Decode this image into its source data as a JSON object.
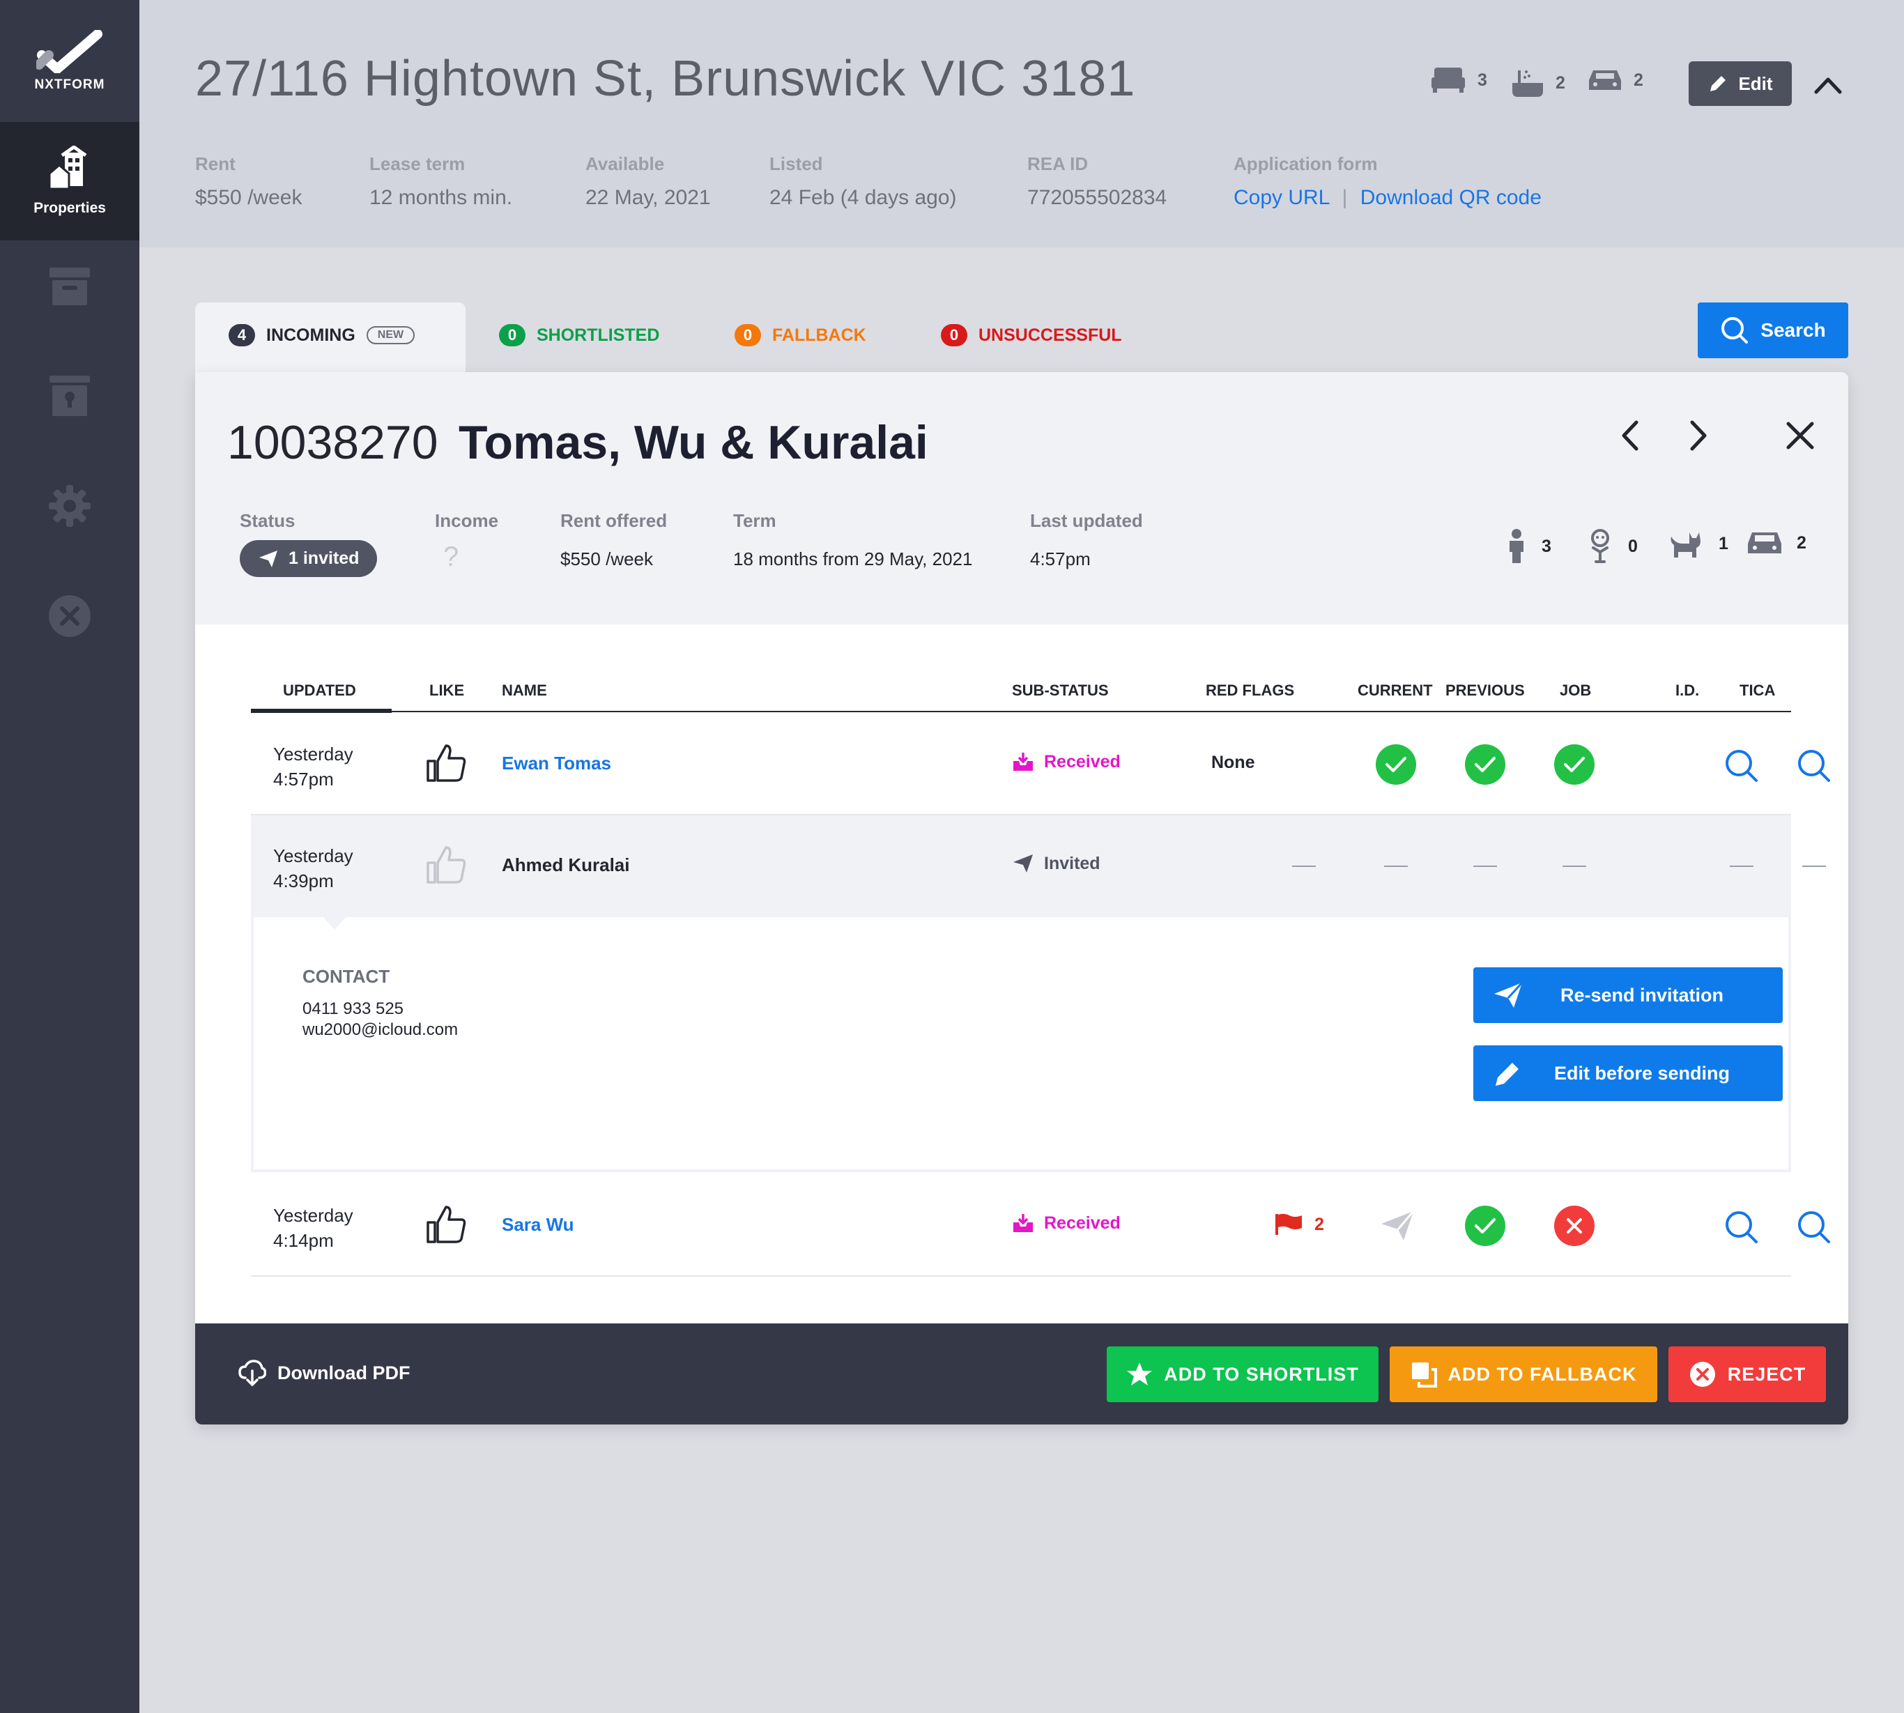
{
  "sidebar": {
    "logo_text": "NXTFORM",
    "properties_label": "Properties",
    "icons": [
      "archive-icon",
      "lockbox-icon",
      "gear-icon",
      "close-circle-icon"
    ]
  },
  "property": {
    "address": "27/116 Hightown St, Brunswick VIC 3181",
    "bedrooms": "3",
    "bathrooms": "2",
    "parking": "2",
    "edit_label": "Edit",
    "meta": [
      {
        "label": "Rent",
        "value": "$550 /week"
      },
      {
        "label": "Lease term",
        "value": "12 months min."
      },
      {
        "label": "Available",
        "value": "22 May, 2021"
      },
      {
        "label": "Listed",
        "value": "24 Feb (4 days ago)"
      },
      {
        "label": "REA ID",
        "value": "772055502834"
      }
    ],
    "application_form": {
      "label": "Application form",
      "copy_url": "Copy URL",
      "separator": "|",
      "download_qr": "Download QR code"
    }
  },
  "tabs": [
    {
      "label": "INCOMING",
      "count": "4",
      "badge": "NEW",
      "color": "#353847"
    },
    {
      "label": "SHORTLISTED",
      "count": "0",
      "color": "#0ca04a"
    },
    {
      "label": "FALLBACK",
      "count": "0",
      "color": "#f5780c"
    },
    {
      "label": "UNSUCCESSFUL",
      "count": "0",
      "color": "#d81a1a"
    }
  ],
  "search_label": "Search",
  "application": {
    "id": "10038270",
    "names": "Tomas, Wu & Kuralai",
    "status_label": "Status",
    "status_value": "1 invited",
    "income_label": "Income",
    "income_value": "?",
    "rent_offered_label": "Rent offered",
    "rent_offered_value": "$550 /week",
    "term_label": "Term",
    "term_value": "18 months from 29 May, 2021",
    "last_updated_label": "Last updated",
    "last_updated_value": "4:57pm",
    "adults": "3",
    "children": "0",
    "pets": "1",
    "cars": "2"
  },
  "table": {
    "headers": [
      "UPDATED",
      "LIKE",
      "NAME",
      "SUB-STATUS",
      "RED FLAGS",
      "CURRENT",
      "PREVIOUS",
      "JOB",
      "I.D.",
      "TICA"
    ],
    "rows": [
      {
        "updated_day": "Yesterday",
        "updated_time": "4:57pm",
        "name": "Ewan Tomas",
        "sub_status": "Received",
        "red_flags": "None"
      },
      {
        "updated_day": "Yesterday",
        "updated_time": "4:39pm",
        "name": "Ahmed Kuralai",
        "sub_status": "Invited",
        "red_flags": "—"
      },
      {
        "updated_day": "Yesterday",
        "updated_time": "4:14pm",
        "name": "Sara Wu",
        "sub_status": "Received",
        "red_flags": "2"
      }
    ]
  },
  "contact": {
    "label": "CONTACT",
    "phone": "0411 933 525",
    "email": "wu2000@icloud.com",
    "resend_label": "Re-send invitation",
    "edit_label": "Edit before sending"
  },
  "footer": {
    "download_pdf": "Download PDF",
    "shortlist": "ADD TO SHORTLIST",
    "fallback": "ADD TO FALLBACK",
    "reject": "REJECT"
  },
  "colors": {
    "accent": "#0f7bea",
    "green": "#22c145",
    "orange": "#f59a10",
    "red": "#f23c3c",
    "magenta": "#e516c8"
  }
}
